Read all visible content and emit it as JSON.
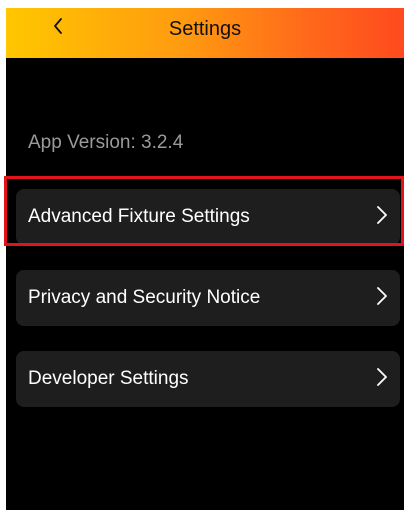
{
  "header": {
    "title": "Settings",
    "back_icon": "chevron-left-icon"
  },
  "app_version": "App Version: 3.2.4",
  "menu": {
    "items": [
      {
        "label": "Advanced Fixture Settings",
        "icon": "chevron-right-icon"
      },
      {
        "label": "Privacy and Security Notice",
        "icon": "chevron-right-icon"
      },
      {
        "label": "Developer Settings",
        "icon": "chevron-right-icon"
      }
    ]
  },
  "colors": {
    "header_gradient_start": "#ffc700",
    "header_gradient_end": "#ff4a1f",
    "background": "#000000",
    "item_background": "#1e1e1e",
    "highlight": "#e0141a",
    "version_text": "#9a9a9a"
  }
}
